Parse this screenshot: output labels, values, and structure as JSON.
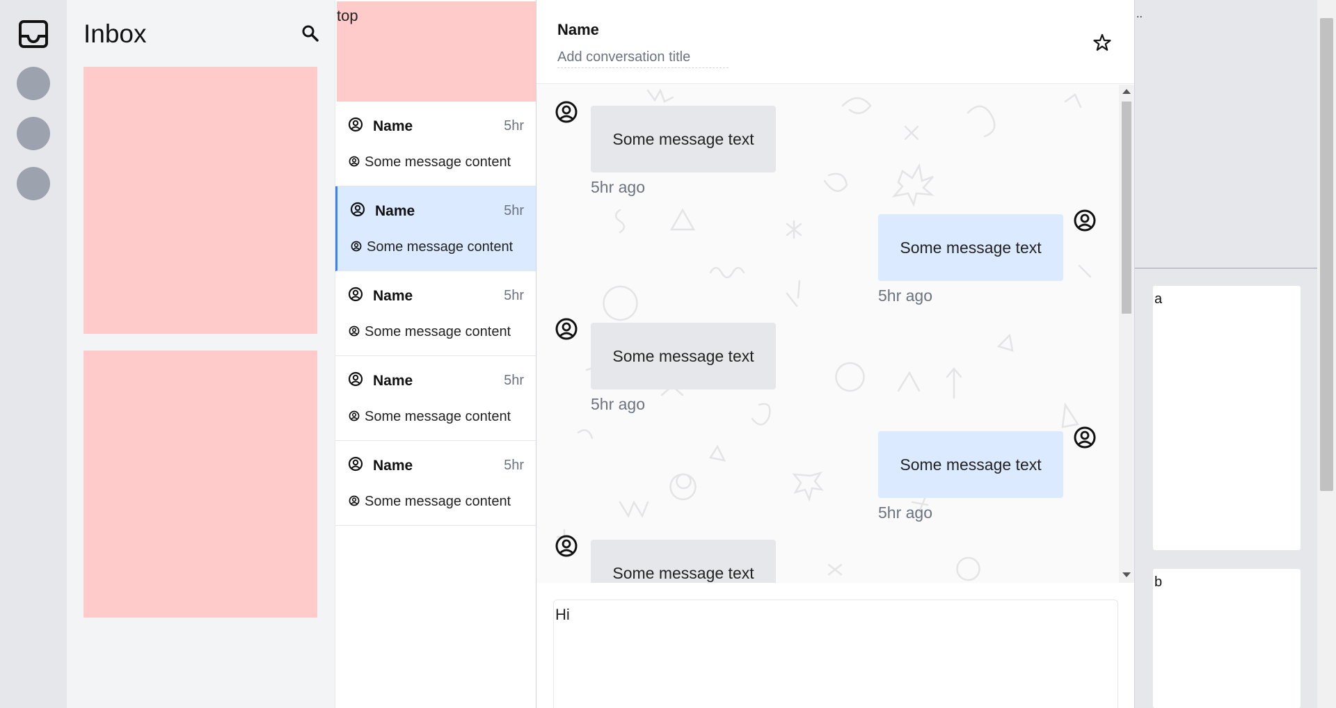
{
  "inbox": {
    "title": "Inbox"
  },
  "convlist": {
    "top_label": "top",
    "items": [
      {
        "name": "Name",
        "time": "5hr",
        "message": "Some message content",
        "active": false
      },
      {
        "name": "Name",
        "time": "5hr",
        "message": "Some message content",
        "active": true
      },
      {
        "name": "Name",
        "time": "5hr",
        "message": "Some message content",
        "active": false
      },
      {
        "name": "Name",
        "time": "5hr",
        "message": "Some message content",
        "active": false
      },
      {
        "name": "Name",
        "time": "5hr",
        "message": "Some message content",
        "active": false
      }
    ]
  },
  "chat": {
    "name": "Name",
    "title_placeholder": "Add conversation title",
    "messages": [
      {
        "text": "Some message text",
        "time": "5hr ago",
        "direction": "in"
      },
      {
        "text": "Some message text",
        "time": "5hr ago",
        "direction": "out"
      },
      {
        "text": "Some message text",
        "time": "5hr ago",
        "direction": "in"
      },
      {
        "text": "Some message text",
        "time": "5hr ago",
        "direction": "out"
      },
      {
        "text": "Some message text",
        "time": "",
        "direction": "in"
      }
    ],
    "composer_value": "Hi"
  },
  "rightpanel": {
    "ellipsis": "..",
    "cards": [
      {
        "label": "a"
      },
      {
        "label": "b"
      }
    ]
  },
  "colors": {
    "placeholder_block": "#fecaca",
    "active_item": "#dbeafe",
    "active_border": "#3b82f6",
    "incoming_bubble": "#e5e7eb",
    "outgoing_bubble": "#dbeafe",
    "avatar_dot": "#9ca3af"
  },
  "icons": {
    "logo": "inbox-tray-icon",
    "search": "search-icon",
    "star": "star-icon",
    "avatar": "user-circle-icon"
  }
}
